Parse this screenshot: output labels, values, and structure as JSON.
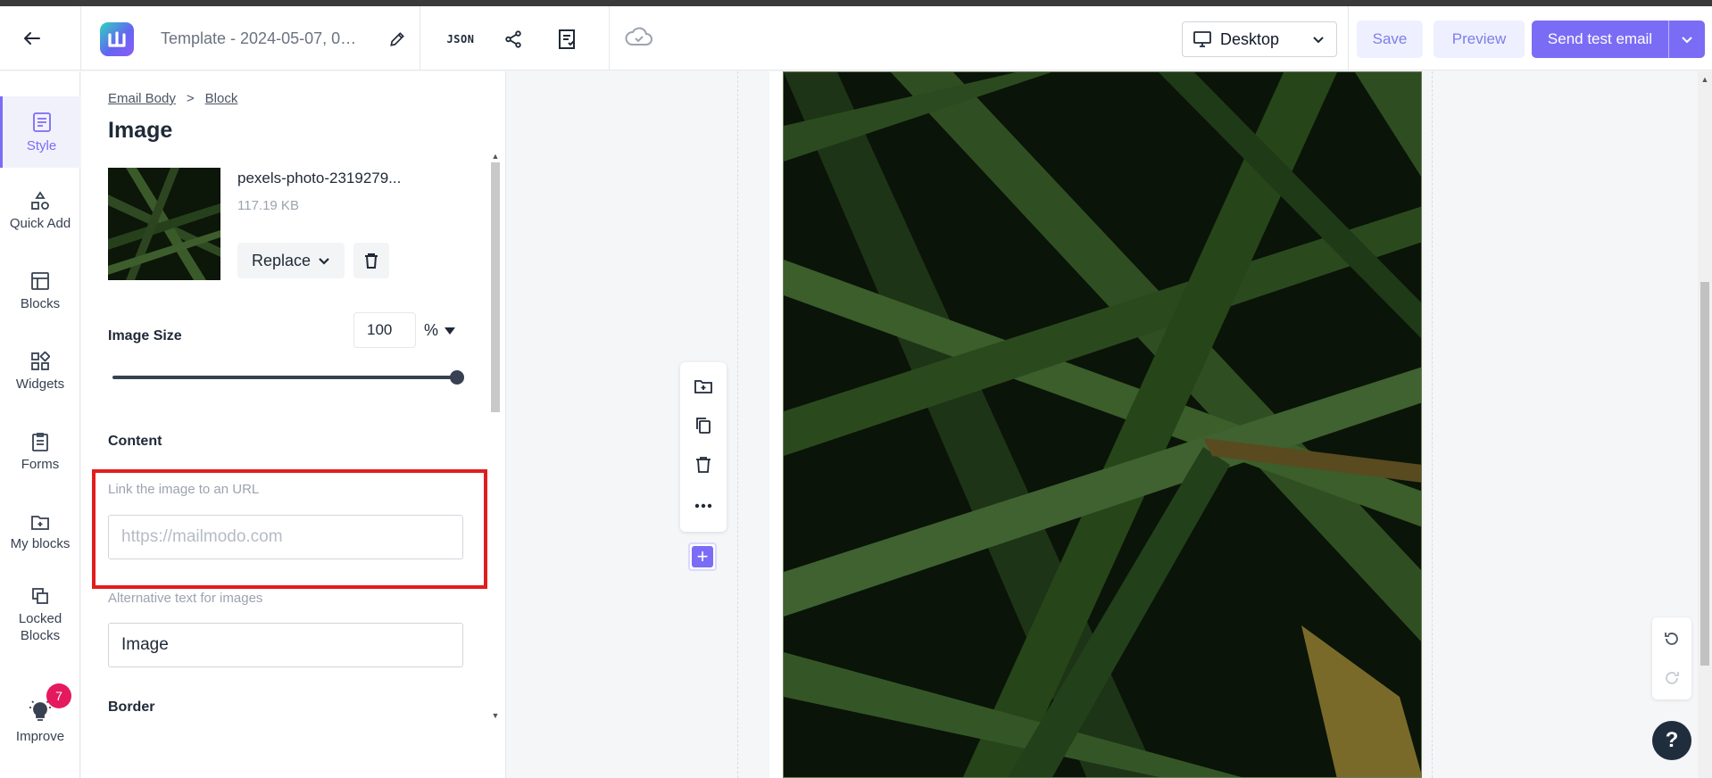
{
  "topbar": {
    "template_name": "Template - 2024-05-07, 07...",
    "json_label": "JSON",
    "device": "Desktop",
    "save_label": "Save",
    "preview_label": "Preview",
    "send_label": "Send test email"
  },
  "nav": {
    "items": [
      {
        "label": "Style",
        "icon": "style-icon"
      },
      {
        "label": "Quick Add",
        "icon": "shapes-icon"
      },
      {
        "label": "Blocks",
        "icon": "layout-icon"
      },
      {
        "label": "Widgets",
        "icon": "widgets-icon"
      },
      {
        "label": "Forms",
        "icon": "clipboard-icon"
      },
      {
        "label": "My blocks",
        "icon": "folder-icon"
      },
      {
        "label": "Locked Blocks",
        "icon": "lock-layers-icon"
      },
      {
        "label": "Improve",
        "icon": "bulb-icon",
        "badge": "7"
      }
    ]
  },
  "panel": {
    "breadcrumb": [
      "Email Body",
      "Block"
    ],
    "breadcrumb_sep": ">",
    "title": "Image",
    "file_name": "pexels-photo-2319279...",
    "file_size": "117.19 KB",
    "replace_label": "Replace",
    "image_size_label": "Image Size",
    "image_size_value": "100",
    "image_size_unit": "%",
    "content_label": "Content",
    "link_label": "Link the image to an URL",
    "link_placeholder": "https://mailmodo.com",
    "alt_label": "Alternative text for images",
    "alt_value": "Image",
    "border_label": "Border"
  },
  "colors": {
    "accent": "#7b6cf6",
    "highlight": "#e11d1d",
    "badge": "#e5195e"
  }
}
